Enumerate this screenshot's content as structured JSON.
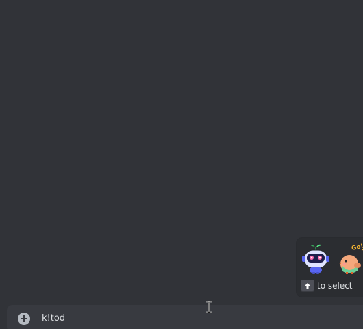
{
  "composer": {
    "value": "k!tod",
    "attach_icon": "plus-circle-icon"
  },
  "sticker_suggestions": {
    "stickers": [
      "robot-sticker",
      "bird-sticker"
    ],
    "hint_key_icon": "arrow-up-icon",
    "hint_text": "to select",
    "sticker_lettering": "Go!"
  },
  "cursor": {
    "type": "ibeam-cursor-icon"
  },
  "colors": {
    "background": "#313338",
    "composer_bg": "#383a40",
    "popup_bg": "#2b2d31",
    "text": "#dbdee1"
  }
}
